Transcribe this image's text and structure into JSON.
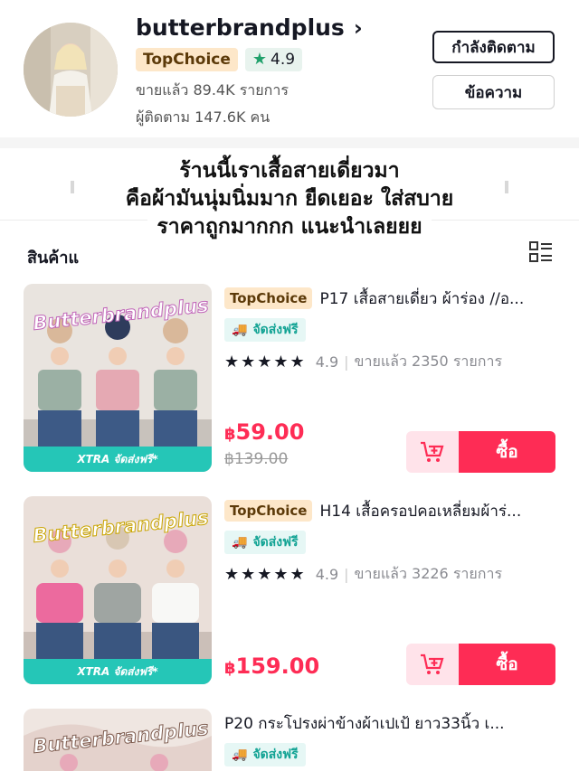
{
  "shop": {
    "name": "butterbrandplus",
    "badge": "TopChoice",
    "rating": "4.9",
    "sold": "ขายแล้ว 89.4K รายการ",
    "followers": "ผู้ติดตาม 147.6K คน",
    "follow_label": "กำลังติดตาม",
    "message_label": "ข้อความ"
  },
  "caption": {
    "line1": "ร้านนี้เราเสื้อสายเดี่ยวมา",
    "line2": "คือผ้ามันนุ่มนิ่มมาก ยืดเยอะ ใส่สบาย",
    "line3": "ราคาถูกมากกก แนะนำเลยยย"
  },
  "section": {
    "title": "สินค้าแ"
  },
  "products": [
    {
      "badge": "TopChoice",
      "title": "P17 เสื้อสายเดี่ยว ผ้าร่อง //อ...",
      "shipping": "จัดส่งฟรี",
      "stars": "★★★★★",
      "rating": "4.9",
      "sold": "ขายแล้ว 2350 รายการ",
      "currency": "฿",
      "price": "59.00",
      "old_price": "฿139.00",
      "image_brand": "Butterbrandplus",
      "image_banner": "XTRA จัดส่งฟรี*",
      "buy_label": "ซื้อ"
    },
    {
      "badge": "TopChoice",
      "title": "H14 เสื้อครอปคอเหลี่ยมผ้าร่...",
      "shipping": "จัดส่งฟรี",
      "stars": "★★★★★",
      "rating": "4.9",
      "sold": "ขายแล้ว 3226 รายการ",
      "currency": "฿",
      "price": "159.00",
      "image_brand": "Butterbrandplus",
      "image_banner": "XTRA จัดส่งฟรี*",
      "buy_label": "ซื้อ"
    },
    {
      "title": "P20 กระโปรงผ่าข้างผ้าเปเป้ ยาว33นิ้ว เ...",
      "shipping": "จัดส่งฟรี",
      "image_brand": "Butterbrandplus"
    }
  ],
  "colors": {
    "accent": "#fe2c55",
    "cart_bg": "#ffe3ea",
    "ship_teal": "#12a394",
    "xtra_teal": "#25c6b7",
    "topchoice_bg": "#fde7c9",
    "rating_star": "#20a06b"
  },
  "icons": {
    "chevron": "chevron-right-icon",
    "star": "star-icon",
    "truck": "truck-icon",
    "cart": "add-to-cart-icon",
    "layout": "list-grid-icon"
  }
}
